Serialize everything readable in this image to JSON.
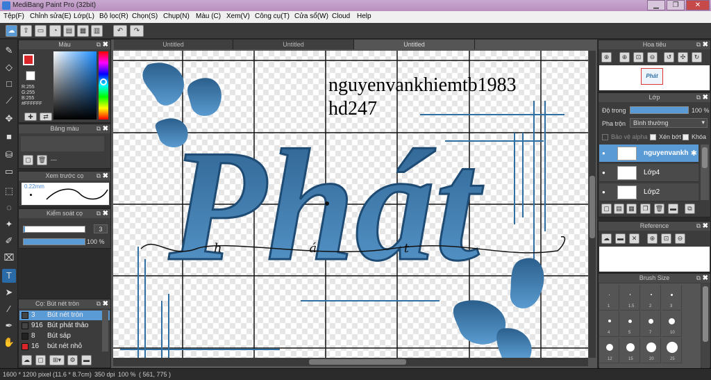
{
  "window": {
    "title": "MediBang Paint Pro (32bit)"
  },
  "menu": [
    "Tệp(F)",
    "Chỉnh sửa(E)",
    "Lớp(L)",
    "Bộ lọc(R)",
    "Chọn(S)",
    "Chụp(N)",
    "Màu (C)",
    "Xem(V)",
    "Công cụ(T)",
    "Cửa sổ(W)",
    "Cloud",
    "Help"
  ],
  "tabs": [
    "Untitled",
    "Untitled",
    "Untitled"
  ],
  "color_panel": {
    "title": "Màu",
    "r_label": "R:255",
    "g_label": "G:255",
    "b_label": "B:255",
    "hex": "#FFFFFF",
    "primary_color": "#d9262a",
    "secondary_color": "#ffffff"
  },
  "palette_panel": {
    "title": "Bảng màu",
    "dash": "---"
  },
  "preview_panel": {
    "title": "Xem trước cọ",
    "size_label": "0.22mm"
  },
  "brush_control": {
    "title": "Kiểm soát cọ",
    "size_value": "3",
    "opacity_value": "100 %",
    "opacity_fraction": 1.0
  },
  "brush_list": {
    "title": "Cọ: Bút nét tròn",
    "items": [
      {
        "size": "3",
        "name": "Bút nét tròn",
        "color": "#444444",
        "selected": true
      },
      {
        "size": "916",
        "name": "Bút phát thảo",
        "color": "#444444",
        "selected": false
      },
      {
        "size": "8",
        "name": "Bút sáp",
        "color": "#222222",
        "selected": false
      },
      {
        "size": "16",
        "name": "bút nét nhỏ",
        "color": "#d9262a",
        "selected": false
      }
    ]
  },
  "navigator": {
    "title": "Hoa tiêu",
    "thumb_text": "Phát"
  },
  "layer_panel": {
    "title": "Lớp",
    "opacity_label": "Độ trong",
    "opacity_value": "100 %",
    "opacity_fraction": 1.0,
    "blend_label": "Pha trộn",
    "blend_value": "Bình thường",
    "protect_alpha": "Bảo vệ alpha",
    "clipping": "Xén bớt",
    "lock": "Khóa",
    "layers": [
      {
        "name": "nguyenvankh",
        "selected": true
      },
      {
        "name": "Lớp4",
        "selected": false
      },
      {
        "name": "Lớp2",
        "selected": false
      }
    ]
  },
  "reference_panel": {
    "title": "Reference"
  },
  "brush_size_panel": {
    "title": "Brush Size",
    "sizes": [
      "1",
      "1.5",
      "2",
      "3",
      "4",
      "5",
      "7",
      "10",
      "12",
      "15",
      "20",
      "25"
    ]
  },
  "canvas": {
    "watermark_line1": "nguyenvankhiemtb1983",
    "watermark_line2": "hd247",
    "art_text": "Phát",
    "script_text": "h á t",
    "art_color": "#2f6fa3"
  },
  "status": {
    "size": "1600 * 1200 pixel",
    "dimensions": "(11.6 * 8.7cm)",
    "dpi": "350 dpi",
    "zoom": "100 %",
    "coords": "( 561, 775 )"
  }
}
